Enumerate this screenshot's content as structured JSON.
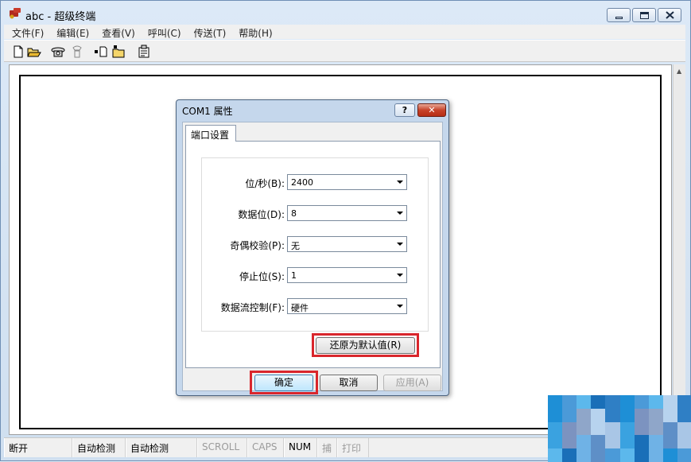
{
  "window": {
    "title": "abc - 超级终端",
    "menu": [
      "文件(F)",
      "编辑(E)",
      "查看(V)",
      "呼叫(C)",
      "传送(T)",
      "帮助(H)"
    ],
    "toolbar_icons": [
      "new-icon",
      "open-icon",
      "call-icon",
      "disconnect-icon",
      "send-icon",
      "receive-icon",
      "properties-icon"
    ]
  },
  "statusbar": {
    "connection": "断开",
    "detect1": "自动检测",
    "detect2": "自动检测",
    "scroll": "SCROLL",
    "caps": "CAPS",
    "num": "NUM",
    "capture": "捕",
    "print": "打印"
  },
  "dialog": {
    "title": "COM1 属性",
    "help": "?",
    "tab": "端口设置",
    "fields": [
      {
        "label": "位/秒(B):",
        "value": "2400"
      },
      {
        "label": "数据位(D):",
        "value": "8"
      },
      {
        "label": "奇偶校验(P):",
        "value": "无"
      },
      {
        "label": "停止位(S):",
        "value": "1"
      },
      {
        "label": "数据流控制(F):",
        "value": "硬件"
      }
    ],
    "restore_defaults": "还原为默认值(R)",
    "ok": "确定",
    "cancel": "取消",
    "apply": "应用(A)"
  },
  "colors": {
    "highlight": "#d9262c",
    "close_button": "#c7432a",
    "dialog_frame": "#c5d7ec"
  }
}
